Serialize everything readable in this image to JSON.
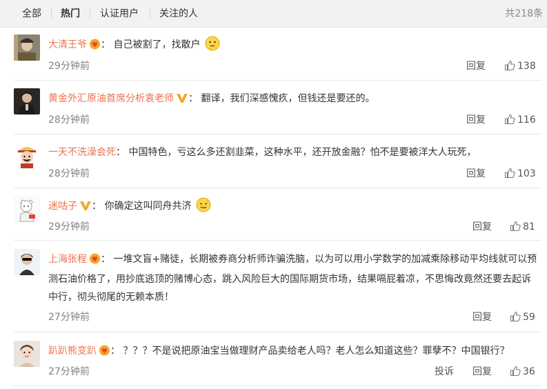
{
  "tabs": [
    {
      "label": "全部"
    },
    {
      "label": "热门"
    },
    {
      "label": "认证用户"
    },
    {
      "label": "关注的人"
    }
  ],
  "total_label": "共218条",
  "colors": {
    "username": "#eb7350",
    "vip_yellow": "#f5a623",
    "text": "#333333",
    "muted": "#808080"
  },
  "comments": [
    {
      "username": "大清王爷",
      "badge": "vip-heart-icon",
      "sep": "：",
      "text": "自己被割了，找散户",
      "emoji": "thinking-face-icon",
      "time": "29分钟前",
      "reply": "回复",
      "likes": "138"
    },
    {
      "username": "黄金外汇原油首席分析袁老师",
      "badge": "verified-v-icon",
      "sep": "：",
      "text": "翻译，我们深感愧疚，但钱还是要还的。",
      "time": "28分钟前",
      "reply": "回复",
      "likes": "116"
    },
    {
      "username": "一天不洗澡会死",
      "sep": "：",
      "text": "中国特色，亏这么多还割韭菜，这种水平，还开放金融？怕不是要被洋大人玩死，",
      "time": "28分钟前",
      "reply": "回复",
      "likes": "103"
    },
    {
      "username": "迷咕子",
      "badge": "verified-v-icon",
      "sep": "：",
      "text": "你确定这叫同舟共济",
      "emoji": "sweat-smile-icon",
      "time": "29分钟前",
      "reply": "回复",
      "likes": "81"
    },
    {
      "username": "上海张程",
      "badge": "vip-heart-icon",
      "sep": "：",
      "text": "一堆文盲+赌徒，长期被券商分析师诈骗洗脑，以为可以用小学数学的加减乘除移动平均线就可以预测石油价格了，用抄底逃顶的赌博心态，跳入风险巨大的国际期货市场，结果嗝屁着凉，不思悔改竟然还要去起诉中行，彻头彻尾的无赖本质！",
      "time": "27分钟前",
      "reply": "回复",
      "likes": "59"
    },
    {
      "username": "趴趴熊变趴",
      "badge": "vip-heart-icon",
      "sep": "：",
      "text": "？？？不是说把原油宝当做理财产品卖给老人吗？老人怎么知道这些？罪孽不？中国银行？",
      "time": "27分钟前",
      "report": "投诉",
      "reply": "回复",
      "likes": "36"
    }
  ]
}
